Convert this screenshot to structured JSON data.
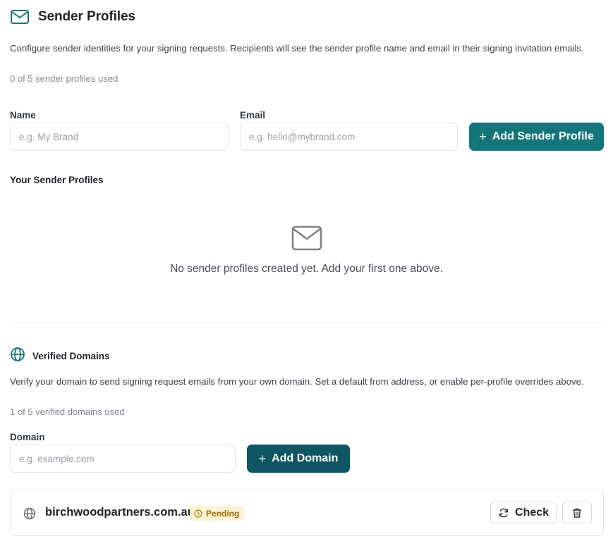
{
  "sender_profiles": {
    "title": "Sender Profiles",
    "description": "Configure sender identities for your signing requests. Recipients will see the sender profile name and email in their signing invitation emails.",
    "usage": "0 of 5 sender profiles used",
    "name_label": "Name",
    "name_placeholder": "e.g. My Brand",
    "name_value": "",
    "email_label": "Email",
    "email_placeholder": "e.g. hello@mybrand.com",
    "email_value": "",
    "add_button_label": "Add Sender Profile",
    "list_title": "Your Sender Profiles",
    "empty_message": "No sender profiles created yet. Add your first one above."
  },
  "verified_domains": {
    "title": "Verified Domains",
    "description": "Verify your domain to send signing request emails from your own domain. Set a default from address, or enable per-profile overrides above.",
    "usage": "1 of 5 verified domains used",
    "domain_label": "Domain",
    "domain_placeholder": "e.g. example.com",
    "domain_value": "",
    "add_button_label": "Add Domain",
    "domains": [
      {
        "name": "birchwoodpartners.com.au",
        "status": "Pending",
        "check_label": "Check"
      }
    ]
  },
  "icons": {
    "header": "mail-icon",
    "empty_state": "mail-icon",
    "domains_header": "globe-icon",
    "domain_row": "globe-icon",
    "status": "clock-icon",
    "check": "refresh-icon",
    "delete": "trash-icon"
  },
  "colors": {
    "accent": "#14767b",
    "accent_dark": "#0e5663",
    "pending_bg": "#fcf4d6",
    "pending_text": "#9a6a05"
  }
}
